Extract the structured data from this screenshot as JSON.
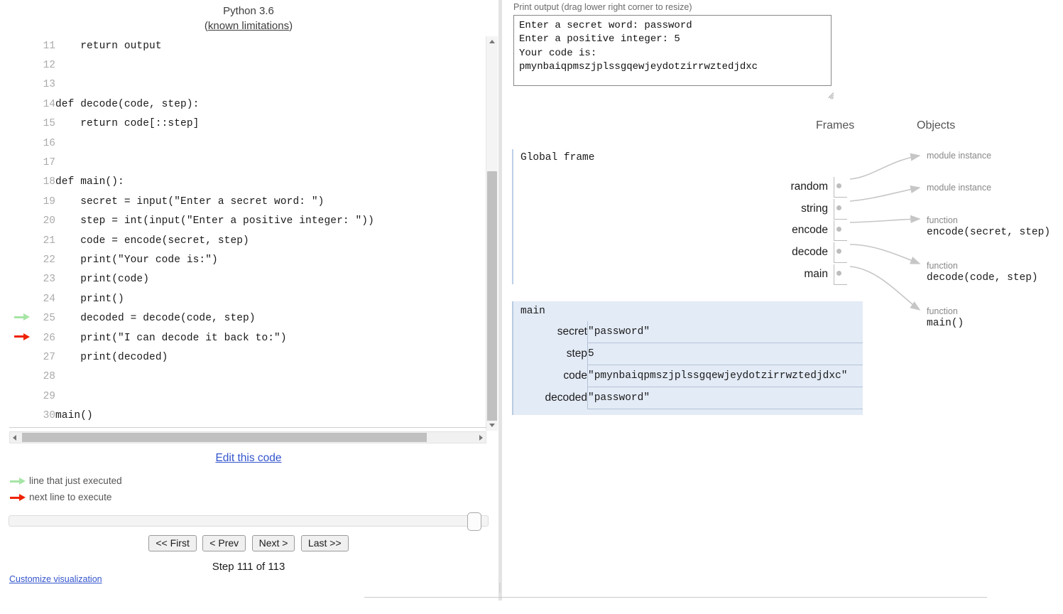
{
  "header": {
    "language": "Python 3.6",
    "limitations_prefix": "(",
    "limitations_link": "known limitations",
    "limitations_suffix": ")"
  },
  "code": {
    "lines": [
      {
        "num": "11",
        "text": "    return output",
        "marker": "none"
      },
      {
        "num": "12",
        "text": "",
        "marker": "none"
      },
      {
        "num": "13",
        "text": "",
        "marker": "none"
      },
      {
        "num": "14",
        "text": "def decode(code, step):",
        "marker": "none"
      },
      {
        "num": "15",
        "text": "    return code[::step]",
        "marker": "none"
      },
      {
        "num": "16",
        "text": "",
        "marker": "none"
      },
      {
        "num": "17",
        "text": "",
        "marker": "none"
      },
      {
        "num": "18",
        "text": "def main():",
        "marker": "none"
      },
      {
        "num": "19",
        "text": "    secret = input(\"Enter a secret word: \")",
        "marker": "none"
      },
      {
        "num": "20",
        "text": "    step = int(input(\"Enter a positive integer: \"))",
        "marker": "none"
      },
      {
        "num": "21",
        "text": "    code = encode(secret, step)",
        "marker": "none"
      },
      {
        "num": "22",
        "text": "    print(\"Your code is:\")",
        "marker": "none"
      },
      {
        "num": "23",
        "text": "    print(code)",
        "marker": "none"
      },
      {
        "num": "24",
        "text": "    print()",
        "marker": "none"
      },
      {
        "num": "25",
        "text": "    decoded = decode(code, step)",
        "marker": "green"
      },
      {
        "num": "26",
        "text": "    print(\"I can decode it back to:\")",
        "marker": "red"
      },
      {
        "num": "27",
        "text": "    print(decoded)",
        "marker": "none"
      },
      {
        "num": "28",
        "text": "",
        "marker": "none"
      },
      {
        "num": "29",
        "text": "",
        "marker": "none"
      },
      {
        "num": "30",
        "text": "main()",
        "marker": "none"
      }
    ]
  },
  "controls": {
    "edit_code": "Edit this code",
    "legend_executed": "line that just executed",
    "legend_next": "next line to execute",
    "first": "<< First",
    "prev": "< Prev",
    "next": "Next >",
    "last": "Last >>",
    "step_counter": "Step 111 of 113",
    "customize": "Customize visualization"
  },
  "print_output": {
    "label": "Print output (drag lower right corner to resize)",
    "text": "Enter a secret word: password\nEnter a positive integer: 5\nYour code is:\npmynbaiqpmszjplssgqewjeydotzirrwztedjdxc"
  },
  "visualization": {
    "frames_label": "Frames",
    "objects_label": "Objects",
    "global_frame": {
      "title": "Global frame",
      "variables": [
        {
          "name": "random"
        },
        {
          "name": "string"
        },
        {
          "name": "encode"
        },
        {
          "name": "decode"
        },
        {
          "name": "main"
        }
      ]
    },
    "objects": [
      {
        "type": "module instance",
        "value": ""
      },
      {
        "type": "module instance",
        "value": ""
      },
      {
        "type": "function",
        "value": "encode(secret, step)"
      },
      {
        "type": "function",
        "value": "decode(code, step)"
      },
      {
        "type": "function",
        "value": "main()"
      }
    ],
    "main_frame": {
      "title": "main",
      "variables": [
        {
          "name": "secret",
          "value": "\"password\""
        },
        {
          "name": "step",
          "value": "5"
        },
        {
          "name": "code",
          "value": "\"pmynbaiqpmszjplssgqewjeydotzirrwztedjdxc\""
        },
        {
          "name": "decoded",
          "value": "\"password\""
        }
      ]
    }
  },
  "colors": {
    "just_executed": "#a6e5a6",
    "next_line": "#ee2200",
    "link": "#3355cc",
    "frame_bg": "#e3ebf6"
  }
}
